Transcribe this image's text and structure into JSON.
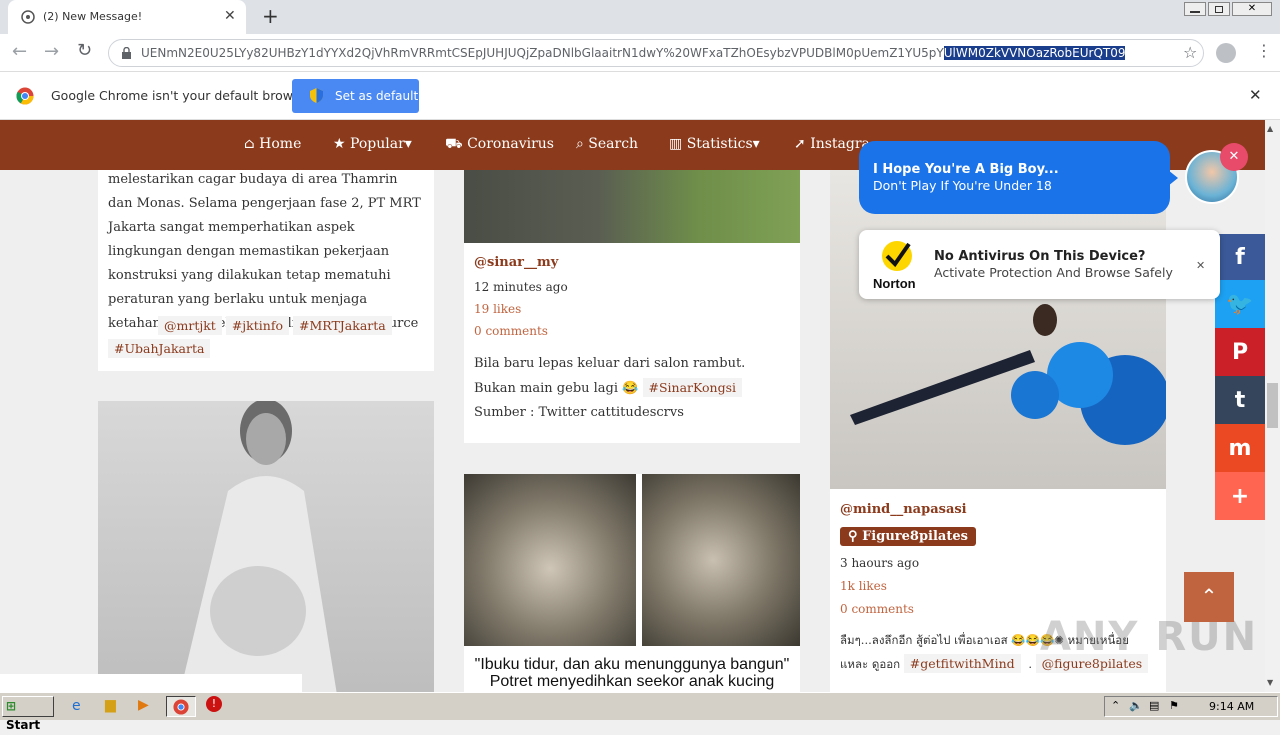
{
  "browser": {
    "tab_title": "(2) New Message!",
    "url_prefix": "UENmN2E0U25LYy82UHBzY1dYYXd2QjVhRmVRRmtCSEpJUHJUQjZpaDNlbGlaaitrN1dwY%20WFxaTZhOEsybzVPUDBlM0pUemZ1YU5pY",
    "url_selected": "UlWM0ZkVVNOazRobEUrQT09",
    "info_text": "Google Chrome isn't your default browser",
    "set_default": "Set as default"
  },
  "nav": {
    "items": [
      "Home",
      "Popular",
      "Coronavirus",
      "Search",
      "Statistics",
      "Instagra"
    ]
  },
  "col1": {
    "text": "melestarikan cagar budaya di area Thamrin dan Monas. Selama pengerjaan fase 2, PT MRT Jakarta sangat memperhatikan aspek lingkungan dengan memastikan pekerjaan konstruksi yang dilakukan tetap mematuhi peraturan yang berlaku untuk menjaga ketahanan dan kelestarian lingkungan - source",
    "tags": [
      "@mrtjkt",
      "#jktinfo",
      "#MRTJakarta",
      "#UbahJakarta"
    ]
  },
  "col2": {
    "user": "@sinar__my",
    "time": "12 minutes ago",
    "likes": "19 likes",
    "comments": "0 comments",
    "text_a": "Bila baru lepas keluar dari salon rambut. Bukan main gebu lagi 😂",
    "tag": "#SinarKongsi",
    "text_b": "Sumber : Twitter cattitudescrvs",
    "caption_1": "\"Ibuku tidur, dan aku menunggunya bangun\"",
    "caption_2": "Potret menyedihkan seekor anak kucing"
  },
  "col3": {
    "user": "@mind__napasasi",
    "location": "Figure8pilates",
    "time": "3 haours ago",
    "likes": "1k likes",
    "comments": "0 comments",
    "text": "ลืมๆ...ลงลึกอีก สู้ต่อไป เพื่อเอาเอส 😂😂😂✺ หมายเหนื่อยแหละ ดูออก",
    "tags": [
      "#getfitwithMind",
      "@figure8pilates"
    ]
  },
  "notifications": [
    {
      "title": "I Hope You're A Big Boy...",
      "sub": "Don't Play If You're Under 18"
    },
    {
      "title": "No Antivirus On This Device?",
      "sub": "Activate Protection And Browse Safely",
      "brand": "Norton"
    }
  ],
  "taskbar": {
    "start": "Start",
    "time": "9:14 AM"
  },
  "watermark": "ANY RUN",
  "colors": {
    "brand": "#8b3a1c",
    "link": "#c0643f",
    "chrome_blue": "#4285f4",
    "notif_blue": "#1a73e8"
  }
}
